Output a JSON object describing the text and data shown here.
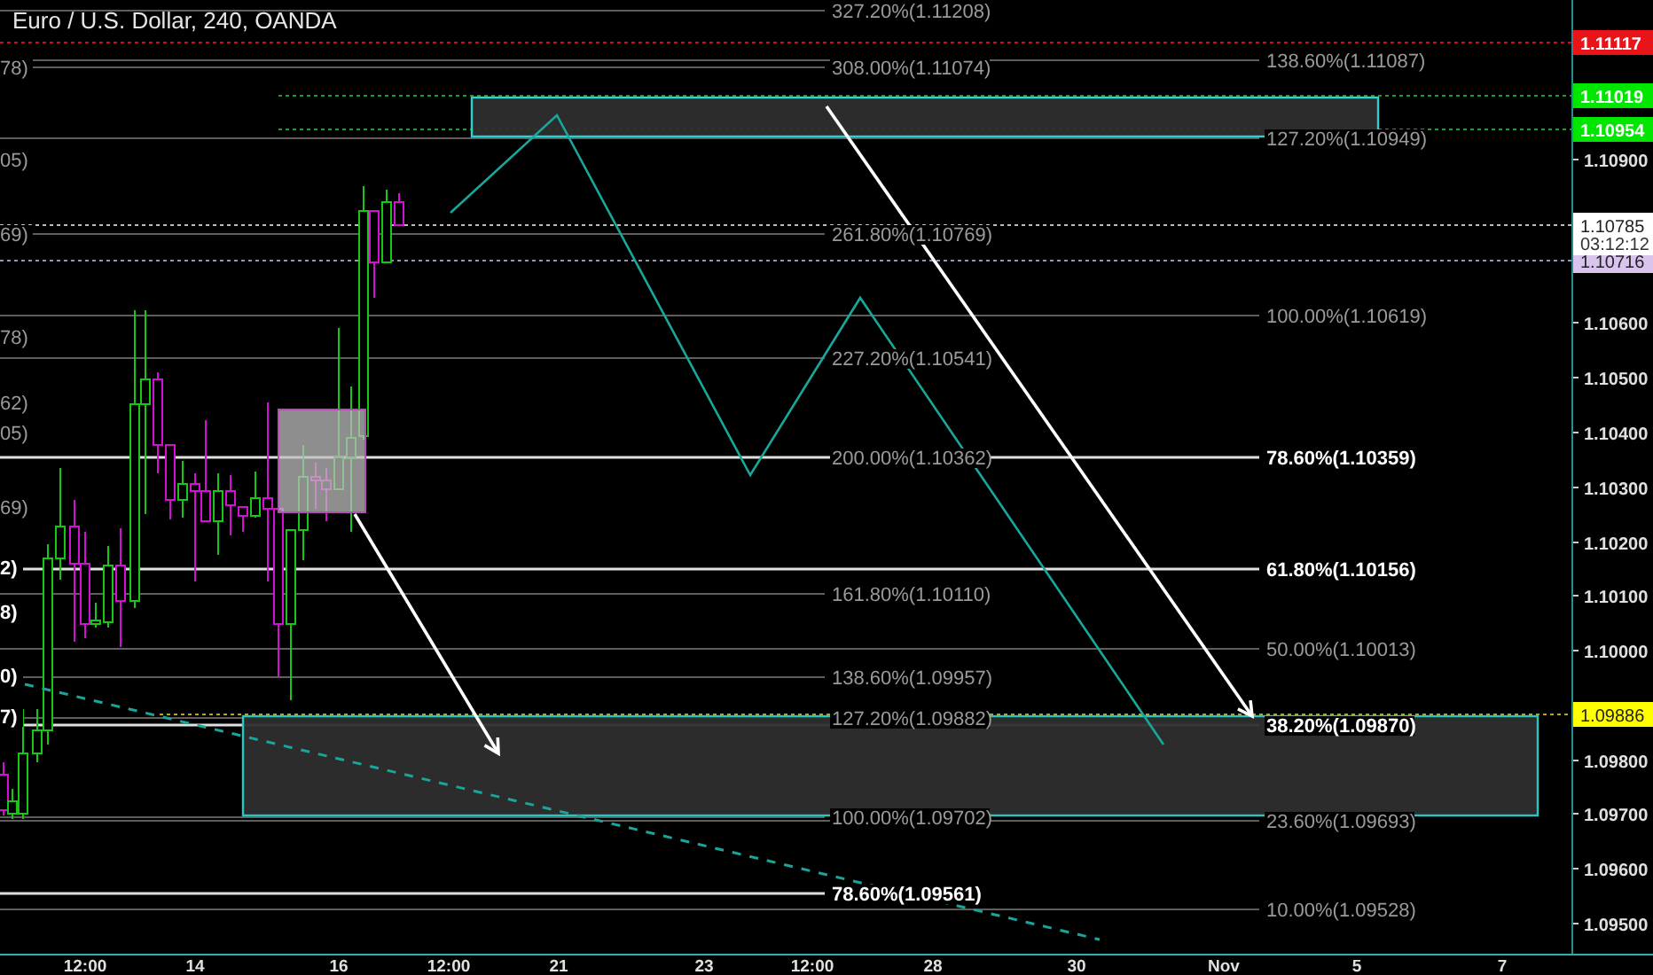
{
  "chart": {
    "title": "Euro / U.S. Dollar, 240, OANDA",
    "fib_left": [
      {
        "label": "327.20%(1.11208)",
        "highlighted": false
      },
      {
        "label": "308.00%(1.11074)",
        "highlighted": false
      },
      {
        "label": "261.80%(1.10769)",
        "highlighted": false
      },
      {
        "label": "227.20%(1.10541)",
        "highlighted": false
      },
      {
        "label": "200.00%(1.10362)",
        "highlighted": false
      },
      {
        "label": "161.80%(1.10110)",
        "highlighted": false
      },
      {
        "label": "138.60%(1.09957)",
        "highlighted": false
      },
      {
        "label": "127.20%(1.09882)",
        "highlighted": false
      },
      {
        "label": "100.00%(1.09702)",
        "highlighted": false
      },
      {
        "label": "78.60%(1.09561)",
        "highlighted": true
      }
    ],
    "fib_right": [
      {
        "label": "138.60%(1.11087)",
        "highlighted": false
      },
      {
        "label": "127.20%(1.10949)",
        "highlighted": false
      },
      {
        "label": "100.00%(1.10619)",
        "highlighted": false
      },
      {
        "label": "78.60%(1.10359)",
        "highlighted": true
      },
      {
        "label": "61.80%(1.10156)",
        "highlighted": true
      },
      {
        "label": "50.00%(1.10013)",
        "highlighted": false
      },
      {
        "label": "38.20%(1.09870)",
        "highlighted": true
      },
      {
        "label": "23.60%(1.09693)",
        "highlighted": false
      },
      {
        "label": "10.00%(1.09528)",
        "highlighted": false
      }
    ],
    "edge_labels": [
      {
        "label": "78)",
        "highlighted": false
      },
      {
        "label": "05)",
        "highlighted": false
      },
      {
        "label": "69)",
        "highlighted": false
      },
      {
        "label": "78)",
        "highlighted": false
      },
      {
        "label": "62)",
        "highlighted": false
      },
      {
        "label": "05)",
        "highlighted": false
      },
      {
        "label": "69)",
        "highlighted": false
      },
      {
        "label": "2)",
        "highlighted": true
      },
      {
        "label": "8)",
        "highlighted": true
      },
      {
        "label": "0)",
        "highlighted": true
      },
      {
        "label": "7)",
        "highlighted": true
      }
    ]
  },
  "price_axis": {
    "ticks": [
      "1.10900",
      "1.10600",
      "1.10500",
      "1.10400",
      "1.10300",
      "1.10200",
      "1.10100",
      "1.10000",
      "1.09800",
      "1.09700",
      "1.09600",
      "1.09500"
    ],
    "price_tags": [
      {
        "label": "1.11117",
        "color": "#e8141a"
      },
      {
        "label": "1.11019",
        "color": "#00e600"
      },
      {
        "label": "1.10954",
        "color": "#00e600"
      },
      {
        "label": "1.10785",
        "color": "#ffffff"
      },
      {
        "label": "1.10716",
        "color": "#d8c4ec"
      },
      {
        "label": "1.09886",
        "color": "#ffff00"
      }
    ],
    "countdown": "03:12:12"
  },
  "time_axis": {
    "labels": [
      "12:00",
      "14",
      "16",
      "12:00",
      "21",
      "23",
      "12:00",
      "28",
      "30",
      "Nov",
      "5",
      "7"
    ]
  }
}
